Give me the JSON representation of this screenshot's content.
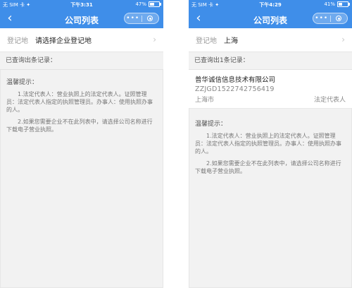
{
  "screens": [
    {
      "status": {
        "carrier": "无 SIM 卡 ✦",
        "time": "下午3:31",
        "battery": "47%",
        "battery_level": 0.47
      },
      "navbar": {
        "back_icon": "‹",
        "title": "公司列表",
        "more_icon": "•••"
      },
      "location": {
        "label": "登记地",
        "value": "请选择企业登记地",
        "chevron": "›"
      },
      "count": "已查询出条记录：",
      "results": [],
      "tips": {
        "title": "温馨提示：",
        "items": [
          "1.法定代表人：营业执照上的法定代表人。证照管理员：法定代表人指定的执照管理员。办事人：使用执照办事的人。",
          "2.如果您需要企业不在此列表中，请选择公司名称进行下载电子营业执照。"
        ]
      }
    },
    {
      "status": {
        "carrier": "无 SIM 卡 ✦",
        "time": "下午4:29",
        "battery": "41%",
        "battery_level": 0.41
      },
      "navbar": {
        "back_icon": "‹",
        "title": "公司列表",
        "more_icon": "•••"
      },
      "location": {
        "label": "登记地",
        "value": "上海",
        "chevron": "›"
      },
      "count": "已查询出1条记录：",
      "results": [
        {
          "name": "普华诚信信息技术有限公司",
          "code": "ZZJGD1522742756419",
          "city": "上海市",
          "role": "法定代表人"
        }
      ],
      "tips": {
        "title": "温馨提示：",
        "items": [
          "1.法定代表人：营业执照上的法定代表人。证照管理员：法定代表人指定的执照管理员。办事人：使用执照办事的人。",
          "2.如果您需要企业不在此列表中，请选择公司名称进行下载电子营业执照。"
        ]
      }
    }
  ]
}
